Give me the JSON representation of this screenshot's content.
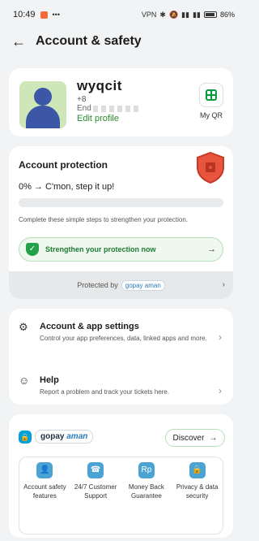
{
  "status": {
    "time": "10:49",
    "battery": "86%"
  },
  "header": {
    "title": "Account & safety"
  },
  "profile": {
    "name": "wyqcit",
    "phone": "+8",
    "status": "End",
    "edit_label": "Edit profile",
    "qr_label": "My QR"
  },
  "protection": {
    "title": "Account protection",
    "progress_text": "0% → C'mon, step it up!",
    "progress": 0,
    "steps_text": "Complete these simple steps to strengthen your protection.",
    "cta_label": "Strengthen your protection now",
    "protected_by": "Protected by",
    "partner": "gopay aman"
  },
  "settings": {
    "items": [
      {
        "title": "Account & app settings",
        "desc": "Control your app preferences, data, linked apps and more."
      },
      {
        "title": "Help",
        "desc": "Report a problem and track your tickets here."
      }
    ]
  },
  "gopay_aman": {
    "brand": "gopay",
    "brand_suffix": "aman",
    "discover_label": "Discover",
    "features": [
      {
        "label": "Account safety features"
      },
      {
        "label": "24/7 Customer Support"
      },
      {
        "label": "Money Back Guarantee"
      },
      {
        "label": "Privacy & data security"
      }
    ]
  }
}
